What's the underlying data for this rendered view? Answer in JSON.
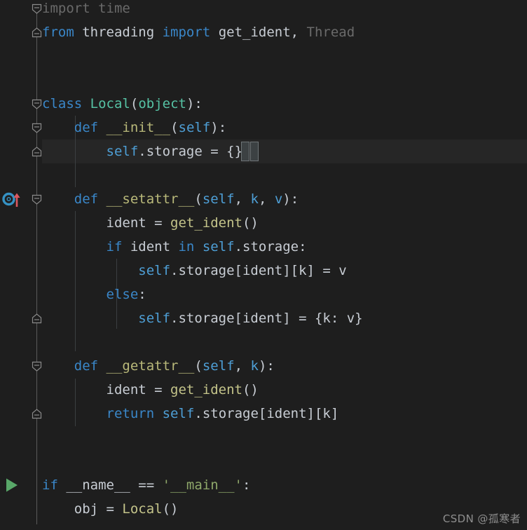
{
  "editor": {
    "background_color": "#1e1e1e",
    "current_line_color": "#262626",
    "language": "Python",
    "font_size_px": 19,
    "line_height_px": 34
  },
  "colors": {
    "keyword": "#3a87c9",
    "class_name": "#56c2a4",
    "function_name": "#c4c48a",
    "parameter": "#4e9fd6",
    "string": "#8fa86a",
    "plain_text": "#c8cdd4",
    "grayed_out": "#6a6a6a",
    "gutter_line": "#5a5a5a",
    "indent_guide": "#3b3f41",
    "run_arrow": "#59a869",
    "override_icon_ring": "#3592c4",
    "override_icon_arrow": "#db5860",
    "brace_highlight_bg": "#3c4143",
    "brace_highlight_border": "#6e7477"
  },
  "gutter": {
    "icons": [
      {
        "name": "override-method-marker",
        "line": 8,
        "tooltip": "Overrides method in object"
      },
      {
        "name": "run-script-arrow",
        "line": 20,
        "tooltip": "Run"
      }
    ],
    "fold_markers": [
      {
        "line": 1,
        "type": "collapse"
      },
      {
        "line": 2,
        "type": "end"
      },
      {
        "line": 5,
        "type": "collapse"
      },
      {
        "line": 6,
        "type": "collapse"
      },
      {
        "line": 7,
        "type": "end"
      },
      {
        "line": 9,
        "type": "collapse"
      },
      {
        "line": 13,
        "type": "end"
      },
      {
        "line": 15,
        "type": "collapse"
      },
      {
        "line": 17,
        "type": "end"
      }
    ]
  },
  "brace_highlight": {
    "open": "{",
    "close": "}",
    "line": 7
  },
  "watermark": {
    "text": "CSDN @孤寒者"
  },
  "code": {
    "lines": [
      {
        "n": 1,
        "indent": 0,
        "text": "import time"
      },
      {
        "n": 2,
        "indent": 0,
        "text": "from threading import get_ident, Thread"
      },
      {
        "n": 3,
        "indent": 0,
        "text": ""
      },
      {
        "n": 4,
        "indent": 0,
        "text": ""
      },
      {
        "n": 5,
        "indent": 0,
        "text": "class Local(object):"
      },
      {
        "n": 6,
        "indent": 1,
        "text": "def __init__(self):"
      },
      {
        "n": 7,
        "indent": 2,
        "text": "self.storage = {}"
      },
      {
        "n": 8,
        "indent": 0,
        "text": ""
      },
      {
        "n": 9,
        "indent": 1,
        "text": "def __setattr__(self, k, v):"
      },
      {
        "n": 10,
        "indent": 2,
        "text": "ident = get_ident()"
      },
      {
        "n": 11,
        "indent": 2,
        "text": "if ident in self.storage:"
      },
      {
        "n": 12,
        "indent": 3,
        "text": "self.storage[ident][k] = v"
      },
      {
        "n": 13,
        "indent": 2,
        "text": "else:"
      },
      {
        "n": 14,
        "indent": 3,
        "text": "self.storage[ident] = {k: v}"
      },
      {
        "n": 15,
        "indent": 0,
        "text": ""
      },
      {
        "n": 16,
        "indent": 1,
        "text": "def __getattr__(self, k):"
      },
      {
        "n": 17,
        "indent": 2,
        "text": "ident = get_ident()"
      },
      {
        "n": 18,
        "indent": 2,
        "text": "return self.storage[ident][k]"
      },
      {
        "n": 19,
        "indent": 0,
        "text": ""
      },
      {
        "n": 20,
        "indent": 0,
        "text": "if __name__ == '__main__':"
      },
      {
        "n": 21,
        "indent": 1,
        "text": "obj = Local()"
      }
    ]
  }
}
